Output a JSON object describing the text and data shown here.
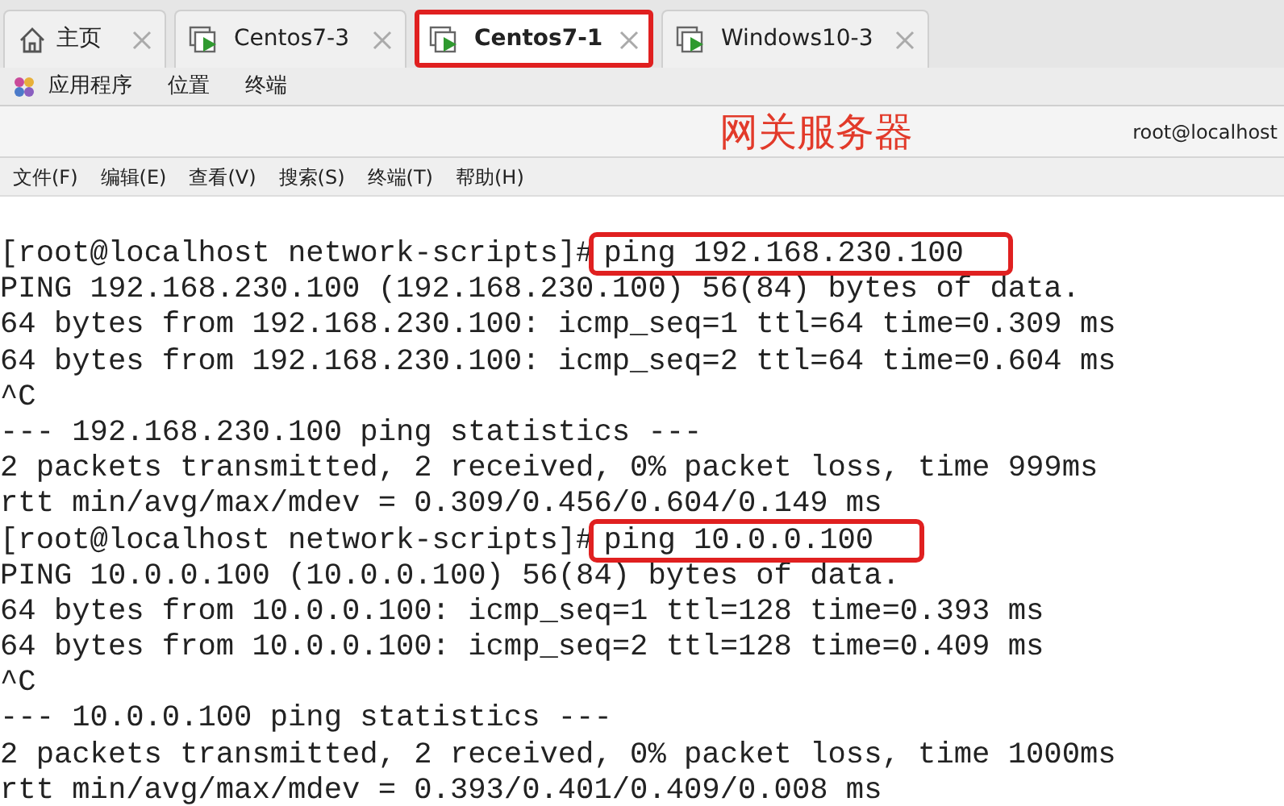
{
  "tabs": [
    {
      "label": "主页",
      "kind": "home",
      "selected": false,
      "highlighted": false
    },
    {
      "label": "Centos7-3",
      "kind": "vm",
      "selected": false,
      "highlighted": false
    },
    {
      "label": "Centos7-1",
      "kind": "vm",
      "selected": true,
      "highlighted": true
    },
    {
      "label": "Windows10-3",
      "kind": "vm",
      "selected": false,
      "highlighted": false
    }
  ],
  "top_bar": {
    "items": [
      "应用程序",
      "位置",
      "终端"
    ]
  },
  "title_bar": {
    "annotation": "网关服务器",
    "title": "root@localhost"
  },
  "menu": [
    "文件(F)",
    "编辑(E)",
    "查看(V)",
    "搜索(S)",
    "终端(T)",
    "帮助(H)"
  ],
  "terminal": {
    "lines": [
      {
        "kind": "prompt",
        "prompt": "[root@localhost network-scripts]#",
        "command": "ping 192.168.230.100",
        "highlighted": true
      },
      {
        "kind": "output",
        "text": "PING 192.168.230.100 (192.168.230.100) 56(84) bytes of data."
      },
      {
        "kind": "output",
        "text": "64 bytes from 192.168.230.100: icmp_seq=1 ttl=64 time=0.309 ms"
      },
      {
        "kind": "output",
        "text": "64 bytes from 192.168.230.100: icmp_seq=2 ttl=64 time=0.604 ms"
      },
      {
        "kind": "output",
        "text": "^C"
      },
      {
        "kind": "output",
        "text": "--- 192.168.230.100 ping statistics ---"
      },
      {
        "kind": "output",
        "text": "2 packets transmitted, 2 received, 0% packet loss, time 999ms"
      },
      {
        "kind": "output",
        "text": "rtt min/avg/max/mdev = 0.309/0.456/0.604/0.149 ms"
      },
      {
        "kind": "prompt",
        "prompt": "[root@localhost network-scripts]#",
        "command": "ping 10.0.0.100",
        "highlighted": true
      },
      {
        "kind": "output",
        "text": "PING 10.0.0.100 (10.0.0.100) 56(84) bytes of data."
      },
      {
        "kind": "output",
        "text": "64 bytes from 10.0.0.100: icmp_seq=1 ttl=128 time=0.393 ms"
      },
      {
        "kind": "output",
        "text": "64 bytes from 10.0.0.100: icmp_seq=2 ttl=128 time=0.409 ms"
      },
      {
        "kind": "output",
        "text": "^C"
      },
      {
        "kind": "output",
        "text": "--- 10.0.0.100 ping statistics ---"
      },
      {
        "kind": "output",
        "text": "2 packets transmitted, 2 received, 0% packet loss, time 1000ms"
      },
      {
        "kind": "output",
        "text": "rtt min/avg/max/mdev = 0.393/0.401/0.409/0.008 ms"
      }
    ]
  }
}
